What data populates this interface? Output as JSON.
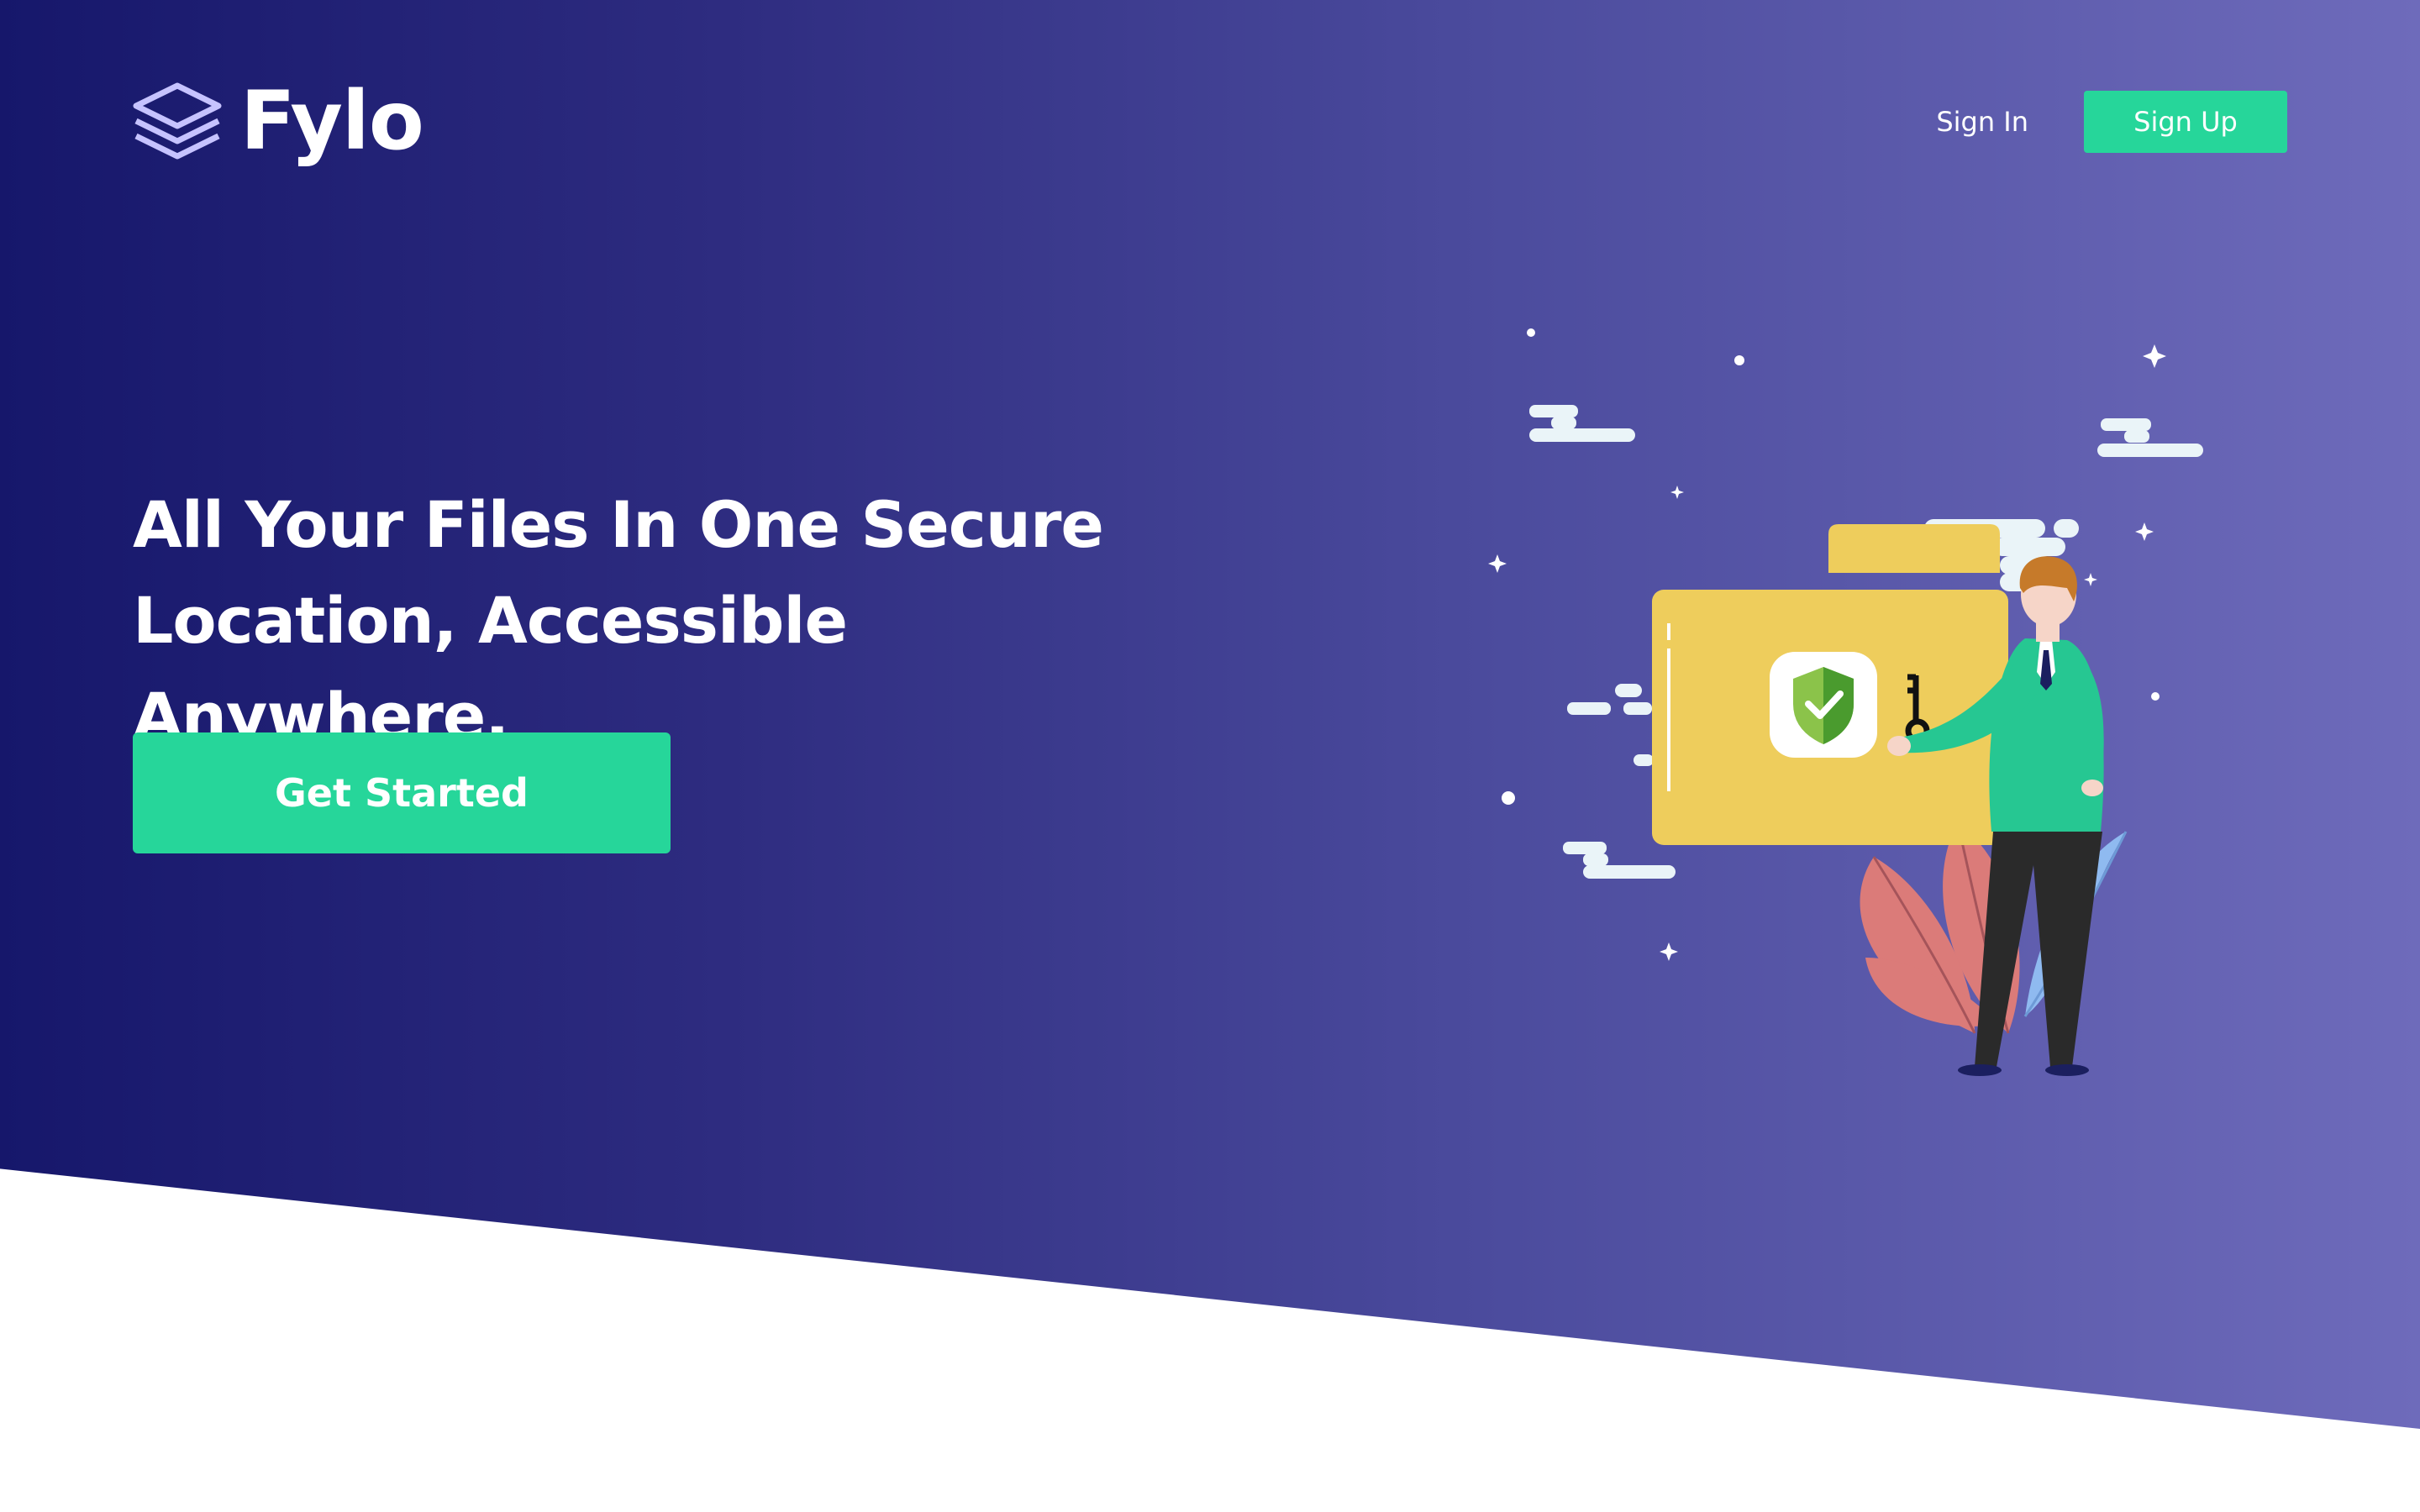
{
  "brand": {
    "name": "Fylo",
    "icon": "layers-icon",
    "icon_color": "#c6c3ff"
  },
  "nav": {
    "sign_in": "Sign In",
    "sign_up": "Sign Up"
  },
  "hero": {
    "headline_line1": "All Your Files In One Secure",
    "headline_line2": "Location, Accessible Anywhere.",
    "cta_label": "Get Started"
  },
  "colors": {
    "accent": "#26d69a",
    "gradient_start": "#16176b",
    "gradient_end": "#6e6bbb",
    "folder": "#eecd5c"
  },
  "illustration": {
    "folder_icon": "folder-icon",
    "shield_icon": "shield-check-icon",
    "key_icon": "key-icon",
    "person": "person-illustration",
    "leaves": "leaves-illustration"
  }
}
